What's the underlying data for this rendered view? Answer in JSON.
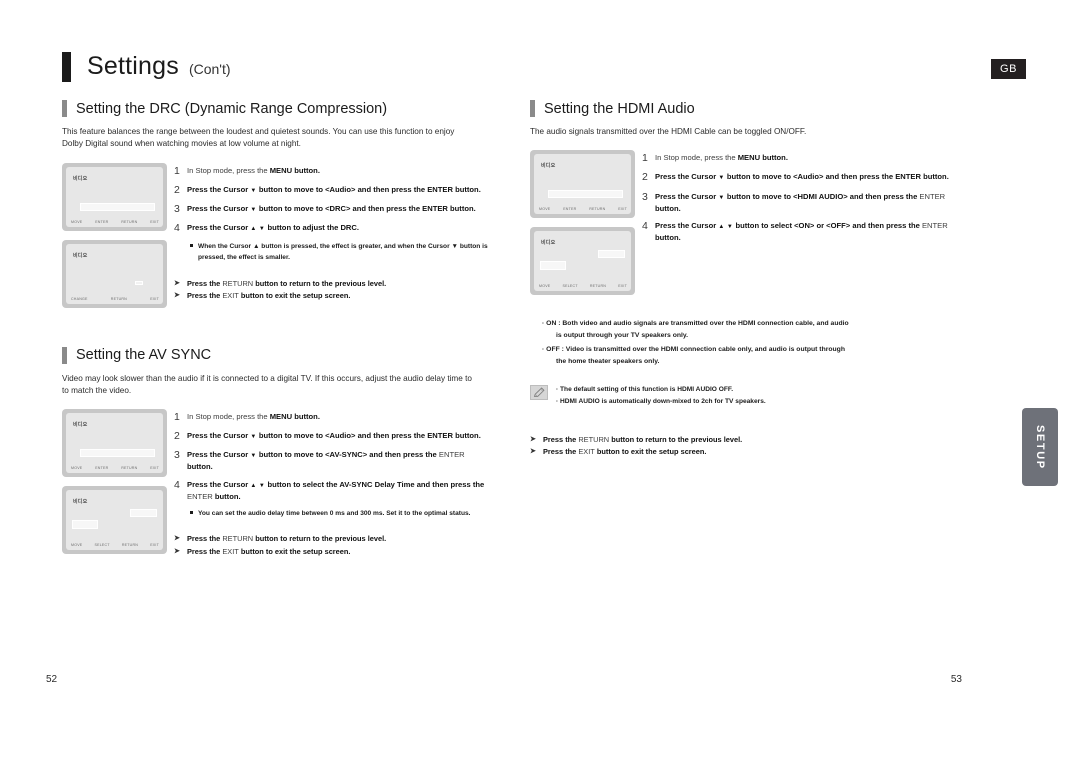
{
  "header": {
    "title": "Settings",
    "cont": "(Con't)",
    "lang_badge": "GB"
  },
  "side_tab": {
    "label": "SETUP"
  },
  "page_numbers": {
    "left": "52",
    "right": "53"
  },
  "icons": {
    "note": "pencil-note-icon",
    "arrow": "➤",
    "cursor_down": "▼",
    "cursor_up": "▲"
  },
  "tv_screen_footer_labels": {
    "move": "MOVE",
    "enter": "ENTER",
    "select": "SELECT",
    "return": "RETURN",
    "exit": "EXIT",
    "change": "CHANGE"
  },
  "tv_screen_heading": "비디오",
  "left_column": {
    "drc": {
      "heading": "Setting the DRC (Dynamic Range Compression)",
      "intro": "This feature balances the range between the loudest and quietest sounds. You can use this function to enjoy Dolby Digital sound when watching movies at low volume at night.",
      "steps": [
        {
          "num": "1",
          "pre": "In Stop mode, press the ",
          "key": "MENU",
          "post": " button."
        },
        {
          "num": "2",
          "pre": "Press the Cursor ",
          "glyph": "▼",
          "mid": " button to move to <Audio> and then press the ",
          "key": "ENTER",
          "post": " button."
        },
        {
          "num": "3",
          "pre": "Press the Cursor ",
          "glyph": "▼",
          "mid": " button to move to <DRC> and then press the ",
          "key": "ENTER",
          "post": " button."
        },
        {
          "num": "4",
          "pre": "Press the Cursor ",
          "glyph": "▲ ▼",
          "mid": " button to adjust the DRC.",
          "key": "",
          "post": ""
        }
      ],
      "subnote": "When the Cursor ▲ button is pressed, the effect is greater, and when the Cursor ▼ button is pressed, the effect is smaller.",
      "arrows": [
        {
          "pre": "Press the ",
          "key": "RETURN",
          "post": " button to return to the previous level."
        },
        {
          "pre": "Press the ",
          "key": "EXIT",
          "post": " button to exit the setup screen."
        }
      ]
    },
    "avsync": {
      "heading": "Setting the AV SYNC",
      "intro": "Video may look slower than the audio if it is connected to a digital TV. If this occurs, adjust the audio delay time to to match the video.",
      "steps": [
        {
          "num": "1",
          "pre": "In Stop mode, press the ",
          "key": "MENU",
          "post": " button."
        },
        {
          "num": "2",
          "pre": "Press the Cursor ",
          "glyph": "▼",
          "mid": " button to move to <Audio> and then press the ",
          "key": "ENTER",
          "post": " button."
        },
        {
          "num": "3",
          "pre": "Press the Cursor ",
          "glyph": "▼",
          "mid": " button to move to <AV-SYNC> and then press the ",
          "key": "ENTER",
          "post": " button."
        },
        {
          "num": "4",
          "pre": "Press the Cursor ",
          "glyph": "▲ ▼",
          "mid": " button to select the AV-SYNC Delay Time  and then press the ",
          "key": "ENTER",
          "post": " button."
        }
      ],
      "subnote": "You can set the audio delay time between 0 ms and 300 ms. Set it to the optimal status.",
      "arrows": [
        {
          "pre": "Press the ",
          "key": "RETURN",
          "post": " button to return to the previous level."
        },
        {
          "pre": "Press the ",
          "key": "EXIT",
          "post": " button to exit the setup screen."
        }
      ]
    }
  },
  "right_column": {
    "hdmi_audio": {
      "heading": "Setting the HDMI Audio",
      "intro": "The audio signals transmitted over the HDMI Cable can be toggled ON/OFF.",
      "steps": [
        {
          "num": "1",
          "pre": "In Stop mode, press the ",
          "key": "MENU",
          "post": " button."
        },
        {
          "num": "2",
          "pre": "Press the Cursor ",
          "glyph": "▼",
          "mid": " button to move to <Audio> and then press the ",
          "key": "ENTER",
          "post": " button."
        },
        {
          "num": "3",
          "pre": "Press the Cursor ",
          "glyph": "▼",
          "mid": " button to move to <HDMI AUDIO> and then press the ",
          "key": "ENTER",
          "post": " button."
        },
        {
          "num": "4",
          "pre": "Press the Cursor ",
          "glyph": "▲ ▼",
          "mid": " button to select <ON> or <OFF> and then press the ",
          "key": "ENTER",
          "post": " button."
        }
      ],
      "bullets": [
        {
          "main": "· ON : Both video and audio signals are transmitted over the HDMI connection cable, and audio",
          "ind": "is output through your TV speakers only."
        },
        {
          "main": "· OFF : Video is transmitted over the HDMI connection cable only, and audio is output through",
          "ind": "the home theater speakers only."
        }
      ],
      "note_lines": [
        "· The default setting of this function is HDMI AUDIO OFF.",
        "· HDMI AUDIO is automatically down-mixed to 2ch for TV speakers."
      ],
      "arrows": [
        {
          "pre": "Press the ",
          "key": "RETURN",
          "post": " button to return to the previous level."
        },
        {
          "pre": "Press the ",
          "key": "EXIT",
          "post": " button to exit the setup screen."
        }
      ]
    }
  }
}
